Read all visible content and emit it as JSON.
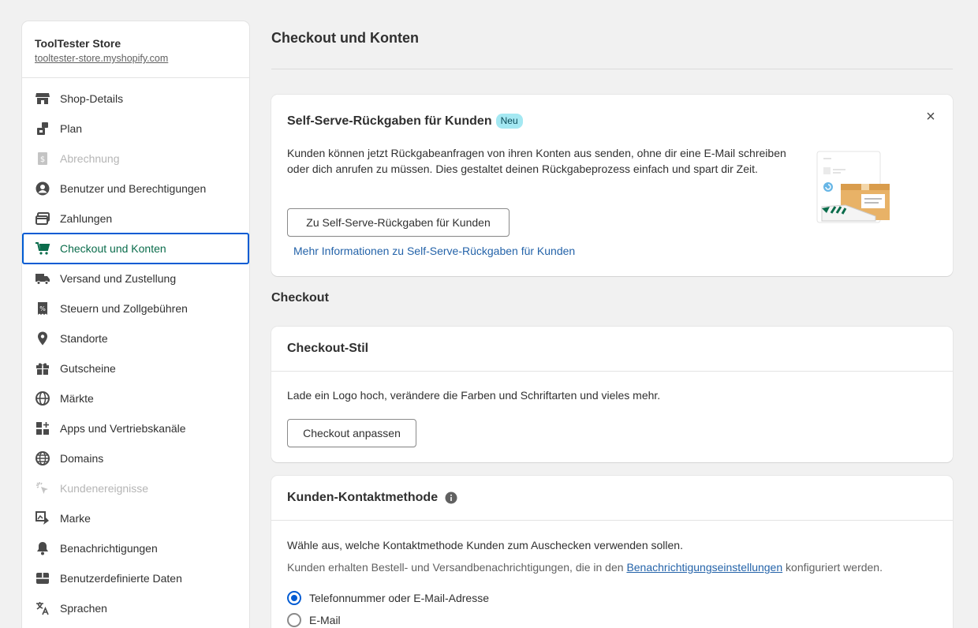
{
  "store": {
    "name": "ToolTester Store",
    "url": "tooltester-store.myshopify.com"
  },
  "sidebar": {
    "items": [
      {
        "label": "Shop-Details",
        "icon": "store-icon"
      },
      {
        "label": "Plan",
        "icon": "plan-icon"
      },
      {
        "label": "Abrechnung",
        "icon": "billing-icon",
        "disabled": true
      },
      {
        "label": "Benutzer und Berechtigungen",
        "icon": "user-icon"
      },
      {
        "label": "Zahlungen",
        "icon": "payments-icon"
      },
      {
        "label": "Checkout und Konten",
        "icon": "cart-icon",
        "active": true
      },
      {
        "label": "Versand und Zustellung",
        "icon": "truck-icon"
      },
      {
        "label": "Steuern und Zollgebühren",
        "icon": "tax-icon"
      },
      {
        "label": "Standorte",
        "icon": "location-icon"
      },
      {
        "label": "Gutscheine",
        "icon": "gift-icon"
      },
      {
        "label": "Märkte",
        "icon": "globe-icon"
      },
      {
        "label": "Apps und Vertriebskanäle",
        "icon": "apps-icon"
      },
      {
        "label": "Domains",
        "icon": "domain-globe-icon"
      },
      {
        "label": "Kundenereignisse",
        "icon": "cursor-click-icon",
        "disabled": true
      },
      {
        "label": "Marke",
        "icon": "brand-icon"
      },
      {
        "label": "Benachrichtigungen",
        "icon": "bell-icon"
      },
      {
        "label": "Benutzerdefinierte Daten",
        "icon": "data-icon"
      },
      {
        "label": "Sprachen",
        "icon": "translate-icon"
      }
    ]
  },
  "page": {
    "title": "Checkout und Konten"
  },
  "promo": {
    "title": "Self-Serve-Rückgaben für Kunden",
    "badge": "Neu",
    "close_icon": "×",
    "body": "Kunden können jetzt Rückgabeanfragen von ihren Konten aus senden, ohne dir eine E-Mail schreiben oder dich anrufen zu müssen. Dies gestaltet deinen Rückgabeprozess einfach und spart dir Zeit.",
    "button_label": "Zu Self-Serve-Rückgaben für Kunden",
    "link_label": "Mehr Informationen zu Self-Serve-Rückgaben für Kunden"
  },
  "checkout_section": {
    "heading": "Checkout"
  },
  "checkout_style": {
    "title": "Checkout-Stil",
    "text": "Lade ein Logo hoch, verändere die Farben und Schriftarten und vieles mehr.",
    "button_label": "Checkout anpassen"
  },
  "contact_method": {
    "title": "Kunden-Kontaktmethode",
    "question": "Wähle aus, welche Kontaktmethode Kunden zum Auschecken verwenden sollen.",
    "note_before": "Kunden erhalten Bestell- und Versandbenachrichtigungen, die in den ",
    "note_link": "Benachrichtigungseinstellungen",
    "note_after": " konfiguriert werden.",
    "options": [
      {
        "label": "Telefonnummer oder E-Mail-Adresse",
        "selected": true
      },
      {
        "label": "E-Mail",
        "selected": false
      }
    ]
  },
  "colors": {
    "active_nav_border": "#005bd3",
    "active_nav_text": "#0a6c4b",
    "link": "#2463a9",
    "badge_bg": "#a4e8f2"
  }
}
